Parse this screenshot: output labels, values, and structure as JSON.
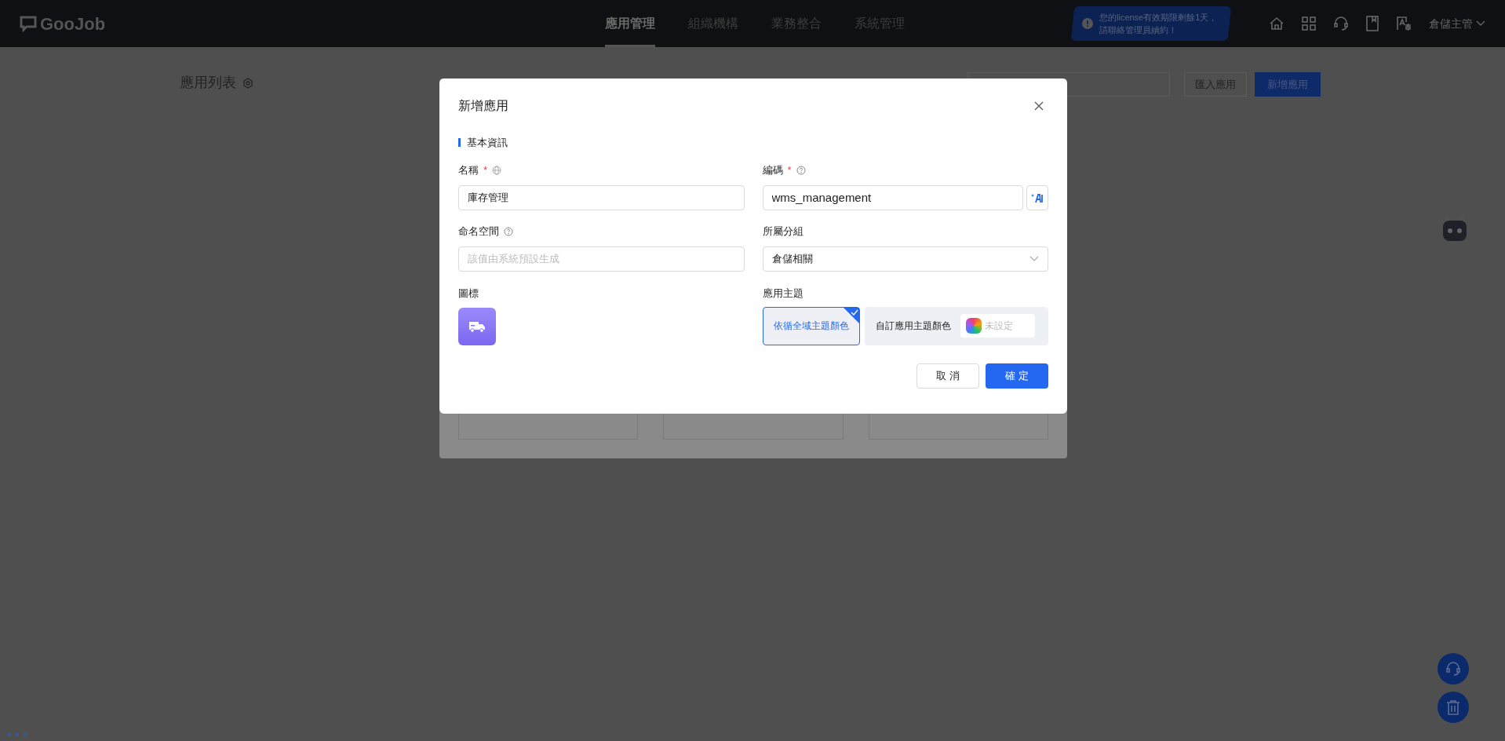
{
  "header": {
    "logo": "GooJob",
    "nav": [
      {
        "label": "應用管理",
        "selected": true
      },
      {
        "label": "組織機構",
        "selected": false
      },
      {
        "label": "業務整合",
        "selected": false
      },
      {
        "label": "系統管理",
        "selected": false
      }
    ],
    "license_notice": "您的license有效期限剩餘1天，請聯絡管理員續約！",
    "user": "倉儲主管"
  },
  "page": {
    "title": "應用列表",
    "buttons": [
      {
        "label": "匯入應用",
        "kind": "default"
      },
      {
        "label": "新增應用",
        "kind": "primary"
      }
    ]
  },
  "dialog": {
    "title": "新增應用",
    "section": "基本資訊",
    "fields": [
      {
        "label": "名稱",
        "required_mark": "*",
        "hint": {
          "kind": "globe"
        },
        "value": "庫存管理",
        "kind": "text"
      },
      {
        "label": "編碼",
        "required_mark": "*",
        "hint": {
          "kind": "help"
        },
        "value": "wms_management",
        "kind": "ai"
      },
      {
        "label": "命名空間",
        "hint": {
          "kind": "help"
        },
        "placeholder": "該值由系統預設生成",
        "kind": "text"
      },
      {
        "label": "所屬分組",
        "value": "倉儲相關",
        "kind": "select"
      }
    ],
    "icon_label": "圖標",
    "theme_label": "應用主題",
    "theme_options": [
      {
        "label": "依循全域主題顏色",
        "selected": true
      },
      {
        "label": "自訂應用主題顏色",
        "selected": false,
        "swatch": "未設定"
      }
    ],
    "buttons": [
      {
        "label": "取 消",
        "kind": "default"
      },
      {
        "label": "確 定",
        "kind": "primary"
      }
    ]
  }
}
